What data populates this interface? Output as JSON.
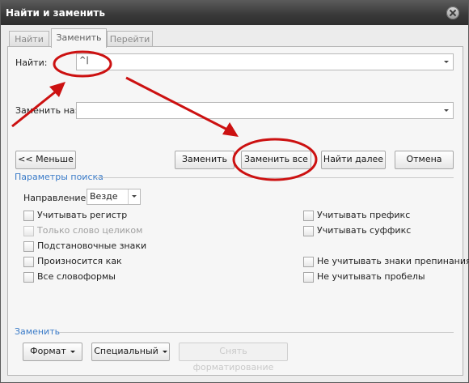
{
  "window": {
    "title": "Найти и заменить"
  },
  "tabs": [
    {
      "label": "Найти"
    },
    {
      "label": "Заменить"
    },
    {
      "label": "Перейти"
    }
  ],
  "find": {
    "label": "Найти:",
    "value": "^|"
  },
  "replace": {
    "label": "Заменить на:",
    "value": ""
  },
  "buttons": {
    "less": "<< Меньше",
    "replace": "Заменить",
    "replace_all": "Заменить все",
    "find_next": "Найти далее",
    "cancel": "Отмена"
  },
  "search_params": {
    "section_label": "Параметры поиска",
    "direction_label": "Направление:",
    "direction_value": "Везде",
    "left_options": [
      {
        "label": "Учитывать регистр",
        "checked": false,
        "enabled": true
      },
      {
        "label": "Только слово целиком",
        "checked": false,
        "enabled": false
      },
      {
        "label": "Подстановочные знаки",
        "checked": false,
        "enabled": true
      },
      {
        "label": "Произносится как",
        "checked": false,
        "enabled": true
      },
      {
        "label": "Все словоформы",
        "checked": false,
        "enabled": true
      }
    ],
    "right_options": [
      {
        "label": "Учитывать префикс",
        "checked": false,
        "enabled": true
      },
      {
        "label": "Учитывать суффикс",
        "checked": false,
        "enabled": true
      },
      {
        "label": "Не учитывать знаки препинания",
        "checked": false,
        "enabled": true
      },
      {
        "label": "Не учитывать пробелы",
        "checked": false,
        "enabled": true
      }
    ]
  },
  "replace_section": {
    "section_label": "Заменить",
    "format_label": "Формат",
    "special_label": "Специальный",
    "no_format_label": "Снять форматирование"
  },
  "annotation": {
    "color": "#cc1111"
  }
}
